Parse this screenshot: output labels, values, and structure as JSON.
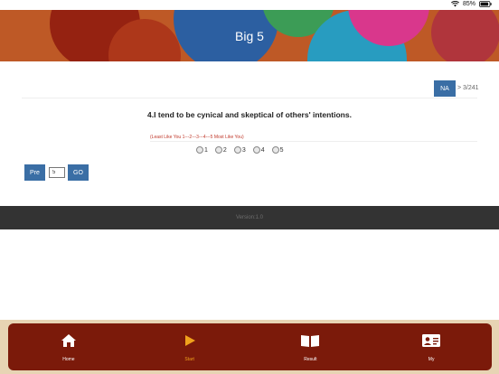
{
  "status_bar": {
    "battery": "85%"
  },
  "header": {
    "title": "Big 5"
  },
  "question": {
    "na_label": "NA",
    "progress": "> 3/241",
    "text": "4.I tend to be cynical and skeptical of others' intentions.",
    "scale_hint": "(Least Like You 1---2---3---4---5 Most Like You)",
    "options": [
      "1",
      "2",
      "3",
      "4",
      "5"
    ]
  },
  "navigation": {
    "pre_label": "Pre",
    "page_value": "5",
    "go_label": "GO"
  },
  "footer": {
    "version": "Version:1.0"
  },
  "tabs": [
    {
      "label": "Home",
      "icon": "home-icon"
    },
    {
      "label": "Start",
      "icon": "play-icon"
    },
    {
      "label": "Result",
      "icon": "book-icon"
    },
    {
      "label": "My",
      "icon": "id-card-icon"
    }
  ],
  "colors": {
    "button_blue": "#3a6ea5",
    "tab_bar": "#7b1a0a",
    "tab_active": "#f0a21c",
    "hint_red": "#c0392b"
  }
}
